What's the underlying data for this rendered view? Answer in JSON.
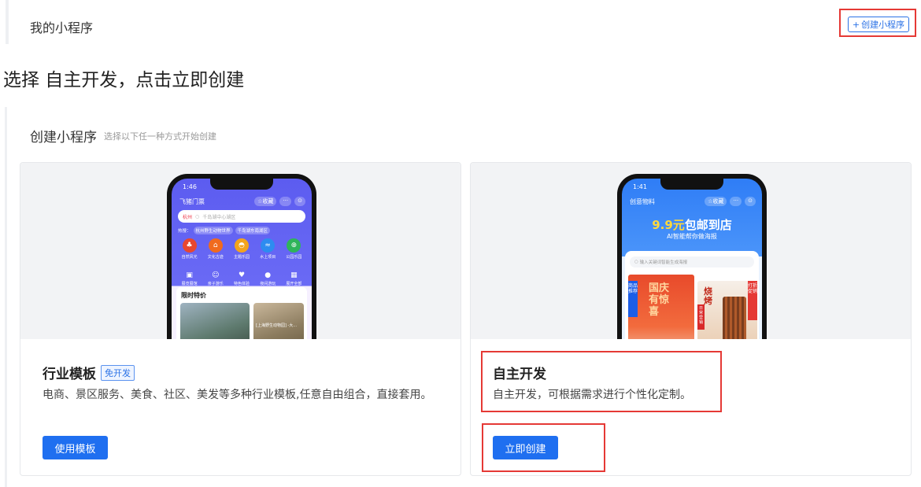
{
  "header": {
    "title": "我的小程序",
    "create_button": {
      "plus": "+",
      "label": "创建小程序"
    }
  },
  "instruction": "选择 自主开发，点击立即创建",
  "panel": {
    "title": "创建小程序",
    "subtitle": "选择以下任一种方式开始创建"
  },
  "cards": [
    {
      "title": "行业模板",
      "badge": "免开发",
      "description": "电商、景区服务、美食、社区、美发等多种行业模板,任意自由组合，直接套用。",
      "button": "使用模板",
      "phone": {
        "time": "1:46",
        "title": "飞猪门票",
        "actions": [
          "☆收藏",
          "···",
          "⊙"
        ],
        "search_city": "杭州",
        "search_placeholder": "千岛湖中心湖区",
        "hot_label": "热搜：",
        "hot_tags": [
          "杭州野生动物世界",
          "千岛湖东南湖区"
        ],
        "icons_row1": [
          {
            "label": "自然风光",
            "color": "#e8472f"
          },
          {
            "label": "文化古迹",
            "color": "#f06a1e"
          },
          {
            "label": "主题乐园",
            "color": "#f3a41c"
          },
          {
            "label": "水上项目",
            "color": "#2d8cf0"
          },
          {
            "label": "公园乐园",
            "color": "#2fb45a"
          }
        ],
        "icons_row2": [
          "展览展馆",
          "亲子游乐",
          "特色体验",
          "夜间游玩",
          "展开全部"
        ],
        "deal_title": "限时特价",
        "deal_caption": "[上海野生动物园] -大..."
      }
    },
    {
      "title": "自主开发",
      "description": "自主开发，可根据需求进行个性化定制。",
      "button": "立即创建",
      "phone": {
        "time": "1:41",
        "title": "创意物料",
        "actions": [
          "☆收藏",
          "···",
          "⊙"
        ],
        "headline_highlight": "9.9元",
        "headline_rest": "包邮到店",
        "subline": "AI智能帮你做海报",
        "search_placeholder": "输入关键词智能生成海报",
        "poster1_side": "商品推荐",
        "poster1_text": "国庆有惊喜",
        "poster2_side": "打折促销",
        "poster2_text": "烧烤",
        "poster2_label": "日常营销"
      }
    }
  ]
}
